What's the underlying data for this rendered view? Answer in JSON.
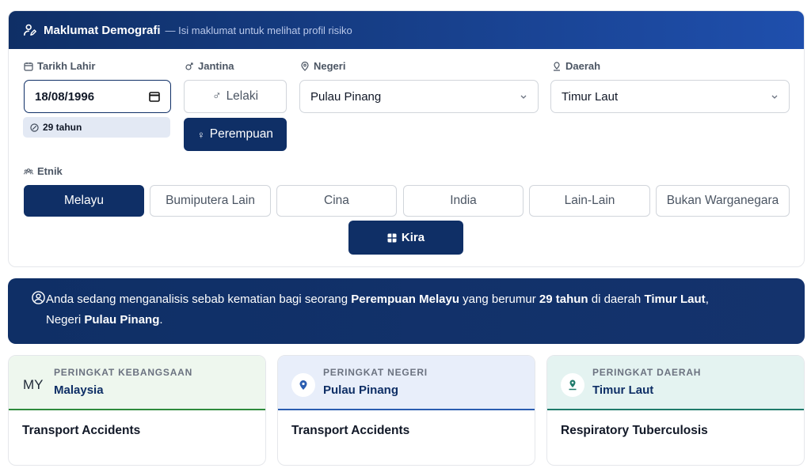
{
  "header": {
    "title": "Maklumat Demografi",
    "subtitle": "— Isi maklumat untuk melihat profil risiko"
  },
  "form": {
    "dob": {
      "label": "Tarikh Lahir",
      "value": "18/08/1996",
      "age": "29 tahun"
    },
    "gender": {
      "label": "Jantina",
      "options": [
        "Lelaki",
        "Perempuan"
      ],
      "selected": "Perempuan"
    },
    "state": {
      "label": "Negeri",
      "value": "Pulau Pinang"
    },
    "district": {
      "label": "Daerah",
      "value": "Timur Laut"
    },
    "ethnicity": {
      "label": "Etnik",
      "options": [
        "Melayu",
        "Bumiputera Lain",
        "Cina",
        "India",
        "Lain-Lain",
        "Bukan Warganegara"
      ],
      "selected": "Melayu"
    },
    "submit_label": "Kira"
  },
  "summary": {
    "p1": "Anda sedang menganalisis sebab kematian bagi seorang ",
    "gender_ethnic": "Perempuan Melayu",
    "p2": " yang berumur ",
    "age": "29 tahun",
    "p3": " di daerah ",
    "district": "Timur Laut",
    "p4": ",",
    "p5": "Negeri ",
    "state": "Pulau Pinang",
    "p6": "."
  },
  "rankings": [
    {
      "caption": "PERINGKAT KEBANGSAAN",
      "badge_text": "MY",
      "place": "Malaysia",
      "cause": "Transport Accidents",
      "tint": "#eef7ee",
      "line": "#2e8b3c"
    },
    {
      "caption": "PERINGKAT NEGERI",
      "place": "Pulau Pinang",
      "cause": "Transport Accidents",
      "tint": "#e8eefa",
      "line": "#2a5db0",
      "icon": "map-pin-icon"
    },
    {
      "caption": "PERINGKAT DAERAH",
      "place": "Timur Laut",
      "cause": "Respiratory Tuberculosis",
      "tint": "#e4f3f1",
      "line": "#1f7a6b",
      "icon": "location-icon"
    }
  ],
  "colors": {
    "primary": "#0f2f66",
    "accent": "#1f4fad"
  }
}
